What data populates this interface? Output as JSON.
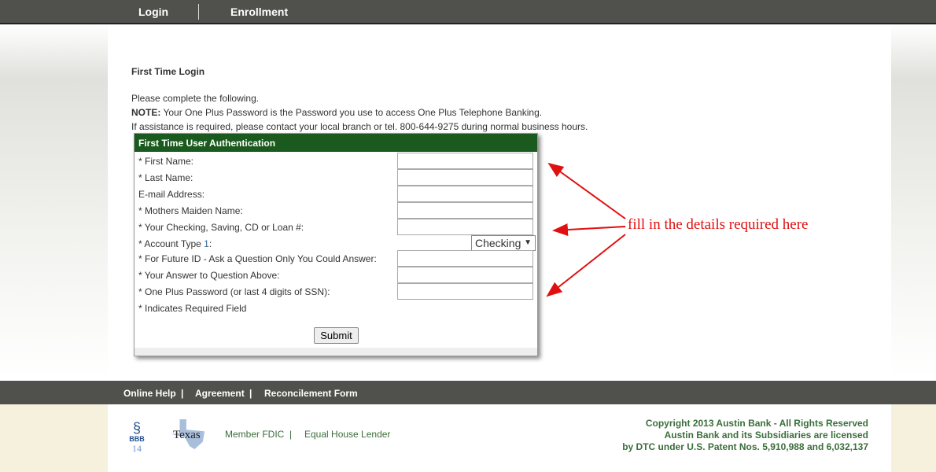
{
  "nav": {
    "login": "Login",
    "enrollment": "Enrollment"
  },
  "page": {
    "title": "First Time Login",
    "line1": "Please complete the following.",
    "note_label": "NOTE:",
    "note_text": " Your One Plus Password is the Password you use to access One Plus Telephone Banking.",
    "line3": "If assistance is required, please contact your local branch or tel. 800-644-9275 during normal business hours."
  },
  "form": {
    "header": "First Time User Authentication",
    "fields": [
      "* First Name:",
      "* Last Name:",
      "E-mail Address:",
      "* Mothers Maiden Name:",
      "* Your Checking, Saving, CD or Loan #:"
    ],
    "account_type_label": "* Account Type ",
    "account_type_num": "1",
    "account_type_suffix": ":",
    "account_type_value": "Checking",
    "fields2": [
      "* For Future ID - Ask a Question Only You Could Answer:",
      "* Your Answer to Question Above:",
      "* One Plus Password (or last 4 digits of SSN):"
    ],
    "required_note": "* Indicates Required Field",
    "submit": "Submit"
  },
  "annotation": "fill in the details required here",
  "footer": {
    "links": [
      "Online Help",
      "|",
      "Agreement",
      "|",
      "Reconcilement Form"
    ],
    "member_fdic": "Member FDIC",
    "sep": "|",
    "equal_housing": "Equal House Lender",
    "bbb": "BBB",
    "bbb_num": "14",
    "texas": "Texas",
    "copyright": [
      "Copyright 2013 Austin Bank - All Rights Reserved",
      "Austin Bank and its Subsidiaries are licensed",
      "by DTC under U.S. Patent Nos. 5,910,988 and 6,032,137"
    ]
  },
  "colors": {
    "header_green": "#1a5a1e",
    "nav_gray": "#50514d",
    "annotation_red": "#e01010"
  }
}
